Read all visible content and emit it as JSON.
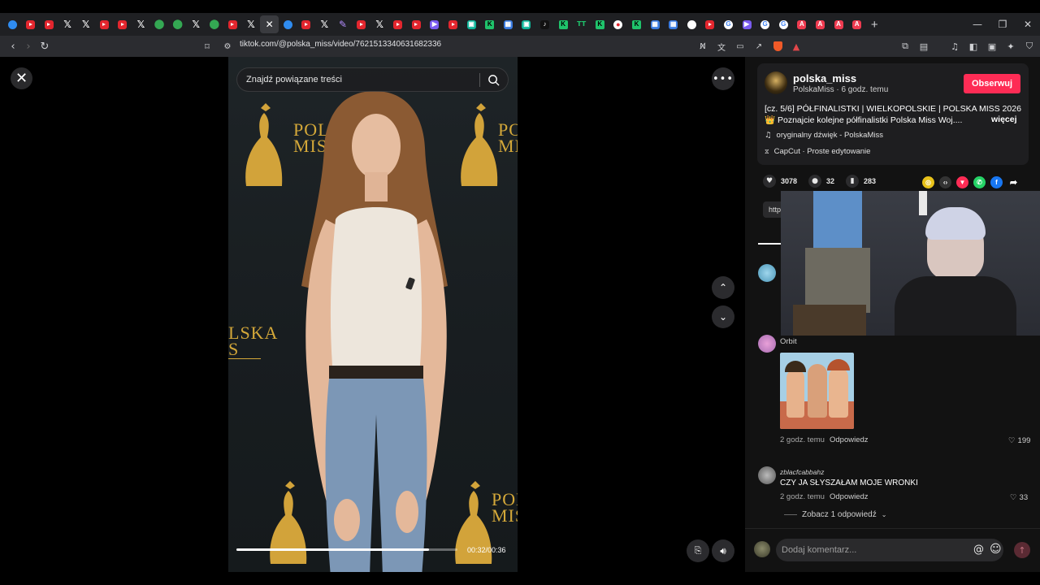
{
  "browser": {
    "tabs": [
      "blue",
      "youtube",
      "youtube",
      "x",
      "x",
      "youtube",
      "youtube",
      "x",
      "maps",
      "maps",
      "x",
      "maps",
      "youtube",
      "x",
      "x-active",
      "blue",
      "youtube",
      "x",
      "feather",
      "youtube",
      "x",
      "youtube",
      "youtube",
      "purple",
      "youtube",
      "teal",
      "green-k",
      "msn",
      "teal",
      "tiktok",
      "green-k",
      "tt",
      "green-k",
      "red-dot",
      "green-k",
      "msn",
      "msn",
      "white",
      "youtube",
      "google",
      "purple",
      "google",
      "google",
      "red-a",
      "red-a",
      "red-a",
      "red-a"
    ],
    "new_tab": "+",
    "url": "tiktok.com/@polska_miss/video/7621513340631682336"
  },
  "video": {
    "search_placeholder": "Znajdź powiązane treści",
    "backdrop_text_top": "POL",
    "backdrop_text_top2": "MISS",
    "backdrop_text_left": "LSKA",
    "backdrop_text_left2": "S",
    "current_time": "00:32",
    "duration": "00:36",
    "time_display": "00:32/00:36",
    "progress": 0.87
  },
  "post": {
    "username": "polska_miss",
    "display_name": "PolskaMiss",
    "posted_ago": "6 godz. temu",
    "meta_line": "PolskaMiss · 6 godz. temu",
    "follow_label": "Obserwuj",
    "caption_line1": "[cz. 5/6] PÓŁFINALISTKI | WIELKOPOLSKIE | POLSKA MISS 2026",
    "caption_line2": "👑 Poznajcie kolejne półfinalistki Polska Miss Woj....",
    "more_label": "więcej",
    "sound": "oryginalny dźwięk - PolskaMiss",
    "capcut": "CapCut · Proste edytowanie",
    "likes": "3078",
    "comments": "32",
    "saves": "283",
    "link_chip": "http"
  },
  "comments": [
    {
      "user": "Orbit",
      "time": "2 godz. temu",
      "reply_label": "Odpowiedz",
      "likes": "199"
    },
    {
      "user": "zblacfcabbahz",
      "text": "CZY JA SŁYSZAŁAM MOJE WRONKI",
      "time": "2 godz. temu",
      "reply_label": "Odpowiedz",
      "likes": "33",
      "view_replies": "Zobacz 1 odpowiedź"
    }
  ],
  "composer": {
    "placeholder": "Dodaj komentarz..."
  },
  "colors": {
    "follow": "#fe2c55",
    "gold": "#d4a839",
    "panel_bg": "#121212"
  }
}
